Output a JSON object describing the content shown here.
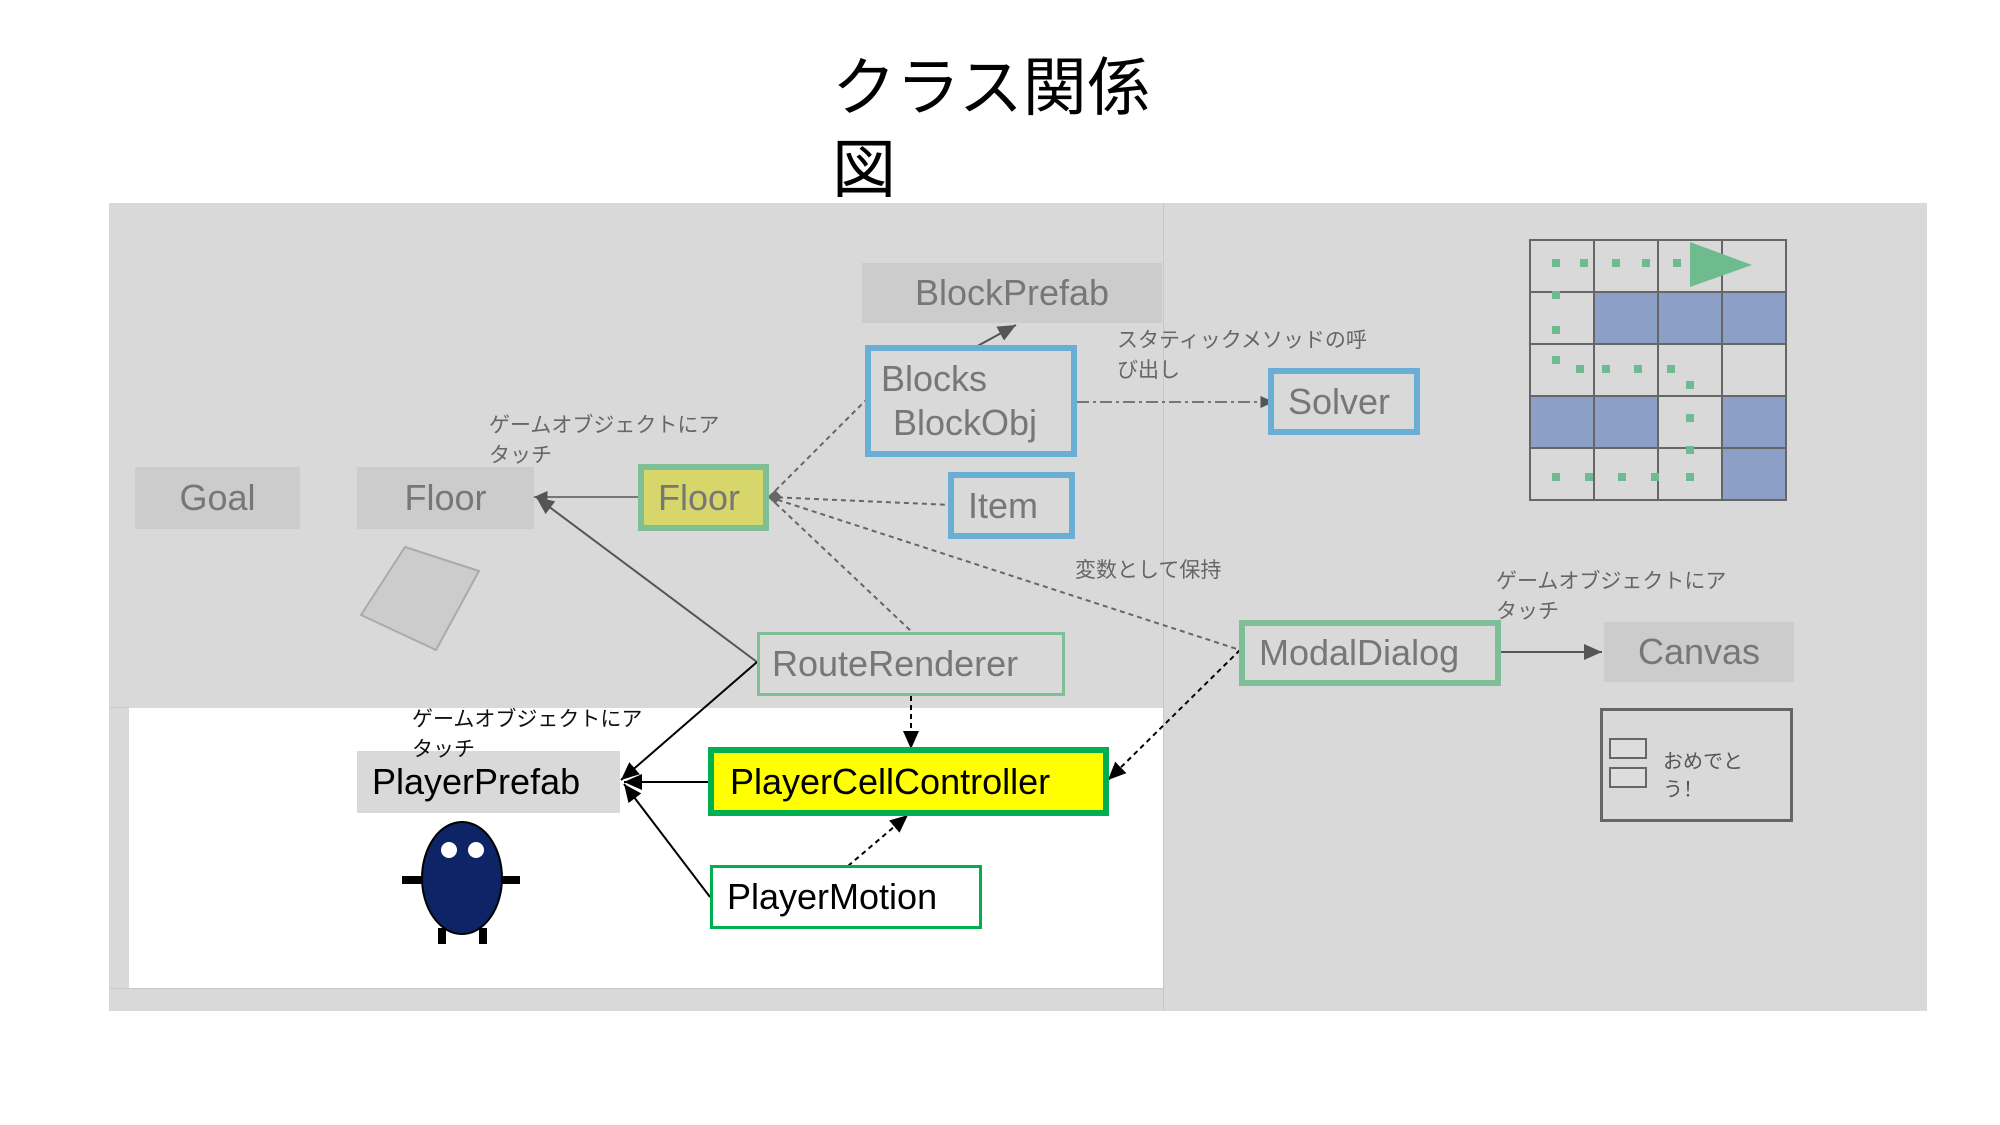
{
  "title": "クラス関係図",
  "nodes": {
    "goal": "Goal",
    "floor_obj": "Floor",
    "block_prefab": "BlockPrefab",
    "blocks": "Blocks",
    "block_obj": "BlockObj",
    "solver": "Solver",
    "floor_class": "Floor",
    "item": "Item",
    "route_renderer": "RouteRenderer",
    "modal_dialog": "ModalDialog",
    "canvas": "Canvas",
    "player_prefab": "PlayerPrefab",
    "player_cell_controller": "PlayerCellController",
    "player_motion": "PlayerMotion"
  },
  "notes": {
    "attach_floor": "ゲームオブジェクトにアタッチ",
    "static_call": "スタティックメソッドの呼び出し",
    "hold_variable": "変数として保持",
    "attach_canvas": "ゲームオブジェクトにアタッチ",
    "attach_player": "ゲームオブジェクトにアタッチ"
  },
  "dialog_preview": {
    "message": "おめでとう！"
  },
  "colors": {
    "blue_border": "#6aaed6",
    "green_border": "#7fbf98",
    "bright_green_border": "#00b050",
    "yellow_fill": "#ffff00",
    "olive_fill": "#d6d66a",
    "grid_blue": "#8c9fc6",
    "dots_green": "#6dbb8f",
    "character_navy": "#0d2566"
  },
  "grid_pattern": {
    "rows": 5,
    "cols": 4,
    "filled_cells": [
      [
        1,
        1
      ],
      [
        1,
        2
      ],
      [
        1,
        3
      ],
      [
        3,
        0
      ],
      [
        3,
        1
      ],
      [
        3,
        3
      ],
      [
        4,
        3
      ]
    ]
  }
}
